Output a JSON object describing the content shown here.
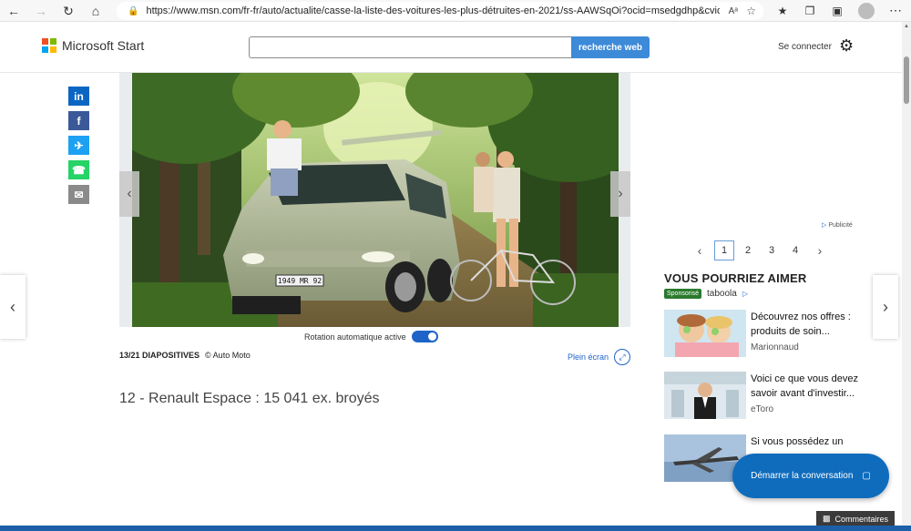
{
  "browser": {
    "url": "https://www.msn.com/fr-fr/auto/actualite/casse-la-liste-des-voitures-les-plus-détruites-en-2021/ss-AAWSqOi?ocid=msedgdhp&cvid=5f775bd...",
    "reader_label": "Aᵃ"
  },
  "header": {
    "logo_text": "Microsoft Start",
    "search_placeholder": "",
    "search_button": "recherche web",
    "signin": "Se connecter"
  },
  "share": [
    {
      "label": "in",
      "color": "#0a66c2",
      "name": "linkedin-icon"
    },
    {
      "label": "f",
      "color": "#3b5998",
      "name": "facebook-icon"
    },
    {
      "label": "✈",
      "color": "#1da1f2",
      "name": "twitter-icon"
    },
    {
      "label": "☎",
      "color": "#25d366",
      "name": "whatsapp-icon"
    },
    {
      "label": "✉",
      "color": "#8a8a8a",
      "name": "email-icon"
    }
  ],
  "slideshow": {
    "plate": "1949 MR 92",
    "rotation_label": "Rotation automatique active",
    "counter": "13/21 DIAPOSITIVES",
    "credit": "© Auto Moto",
    "fullscreen": "Plein écran",
    "caption": "12 - Renault Espace : 15 041 ex. broyés"
  },
  "rail": {
    "ad_label": "Publicité",
    "pages": [
      "1",
      "2",
      "3",
      "4"
    ],
    "title": "VOUS POURRIEZ AIMER",
    "sponsor_badge": "Sponsorisé",
    "sponsor_brand": "taboola",
    "items": [
      {
        "title": "Découvrez nos offres : produits de soin...",
        "source": "Marionnaud"
      },
      {
        "title": "Voici ce que vous devez savoir avant d'investir...",
        "source": "eToro"
      },
      {
        "title": "Si vous possédez un",
        "source": ""
      }
    ]
  },
  "chat_button": "Démarrer la conversation",
  "comments": "Commentaires"
}
